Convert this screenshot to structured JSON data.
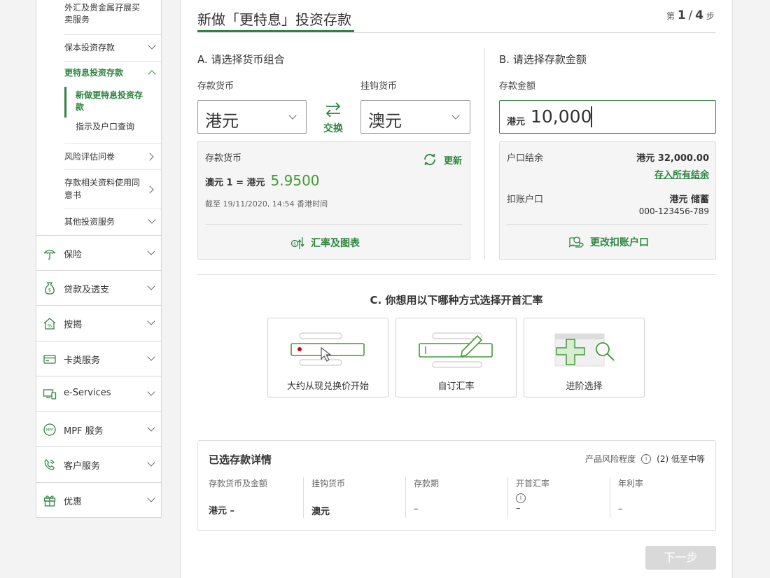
{
  "sidebar": {
    "sub_items": [
      {
        "label_line1": "外汇及贵金属孖展买",
        "label_line2": "卖服务"
      },
      {
        "label": "保本投资存款"
      },
      {
        "label": "更特息投资存款"
      },
      {
        "label_line1": "新做更特息投资存",
        "label_line2": "款"
      },
      {
        "label": "指示及户口查询"
      },
      {
        "label": "风险评估问卷"
      },
      {
        "label_line1": "存款相关资料使用同",
        "label_line2": "意书"
      },
      {
        "label": "其他投资服务"
      }
    ],
    "main_items": [
      {
        "label": "保险",
        "icon": "umbrella-icon"
      },
      {
        "label": "贷款及透支",
        "icon": "money-bag-icon"
      },
      {
        "label": "按揭",
        "icon": "house-percent-icon"
      },
      {
        "label": "卡类服务",
        "icon": "card-icon"
      },
      {
        "label": "e-Services",
        "icon": "devices-icon"
      },
      {
        "label": "MPF 服务",
        "icon": "mpf-icon"
      },
      {
        "label": "客户服务",
        "icon": "phone-hand-icon"
      },
      {
        "label": "优惠",
        "icon": "gift-icon"
      }
    ]
  },
  "header": {
    "title": "新做「更特息」投资存款",
    "step_prefix": "第",
    "step_current": "1",
    "step_sep": "/",
    "step_total": "4",
    "step_suffix": "步"
  },
  "section_a": {
    "title": "A. 请选择货币组合",
    "deposit_label": "存款货币",
    "linked_label": "挂钩货币",
    "deposit_value": "港元",
    "linked_value": "澳元",
    "swap_label": "交换",
    "rate_box": {
      "title": "存款货币",
      "refresh_label": "更新",
      "rate_prefix": "澳元 1 = 港元",
      "rate_value": "5.9500",
      "timestamp": "截至 19/11/2020, 14:54 香港时间",
      "chart_link": "汇率及图表"
    }
  },
  "section_b": {
    "title": "B. 请选择存款金额",
    "amount_label": "存款金额",
    "amount_currency": "港元",
    "amount_value": "10,000",
    "balance_label": "户口结余",
    "balance_value": "港元 32,000.00",
    "deposit_all_link": "存入所有结余",
    "debit_label": "扣账户口",
    "debit_account_name": "港元 储蓄",
    "debit_account_number": "000-123456-789",
    "change_account_link": "更改扣账户口"
  },
  "section_c": {
    "title": "C. 你想用以下哪种方式选择开首汇率",
    "options": [
      {
        "label": "大约从现兑换价开始"
      },
      {
        "label": "自订汇率"
      },
      {
        "label": "进阶选择"
      }
    ]
  },
  "summary": {
    "title": "已选存款详情",
    "risk_label": "产品风险程度",
    "risk_value": "(2) 低至中等",
    "columns": [
      {
        "header": "存款货币及金额",
        "value": "港元 –"
      },
      {
        "header": "挂钩货币",
        "value": "澳元"
      },
      {
        "header": "存款期",
        "value": "–"
      },
      {
        "header": "开首汇率",
        "value": "–"
      },
      {
        "header": "年利率",
        "value": "–"
      }
    ]
  },
  "next_button": "下一步",
  "colors": {
    "accent_green": "#2e8540",
    "rate_green": "#3f9c35",
    "disabled_button": "#d9d9d9",
    "red_dot": "#db0011"
  }
}
